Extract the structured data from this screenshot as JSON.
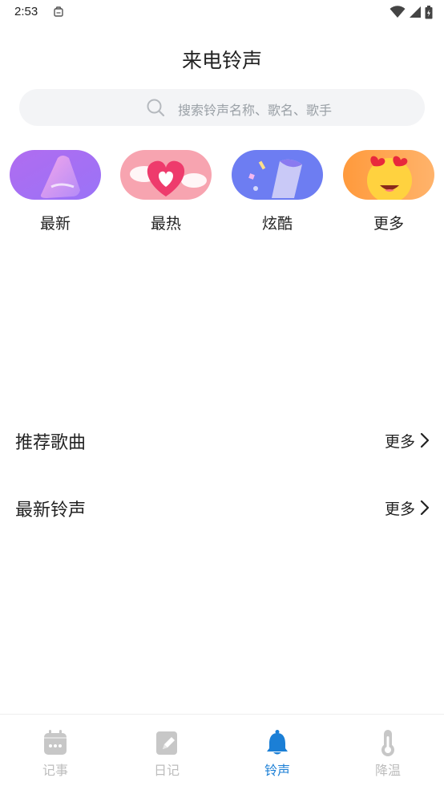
{
  "status_bar": {
    "time": "2:53"
  },
  "header": {
    "title": "来电铃声"
  },
  "search": {
    "placeholder": "搜索铃声名称、歌名、歌手"
  },
  "categories": [
    {
      "label": "最新"
    },
    {
      "label": "最热"
    },
    {
      "label": "炫酷"
    },
    {
      "label": "更多"
    }
  ],
  "sections": [
    {
      "title": "推荐歌曲",
      "more": "更多"
    },
    {
      "title": "最新铃声",
      "more": "更多"
    }
  ],
  "tabbar": {
    "items": [
      {
        "label": "记事",
        "icon": "calendar-icon",
        "active": false
      },
      {
        "label": "日记",
        "icon": "diary-icon",
        "active": false
      },
      {
        "label": "铃声",
        "icon": "bell-icon",
        "active": true
      },
      {
        "label": "降温",
        "icon": "thermometer-icon",
        "active": false
      }
    ]
  },
  "colors": {
    "accent": "#1b7fd6",
    "inactive": "#bdbdbd",
    "search_bg": "#f3f4f6"
  }
}
